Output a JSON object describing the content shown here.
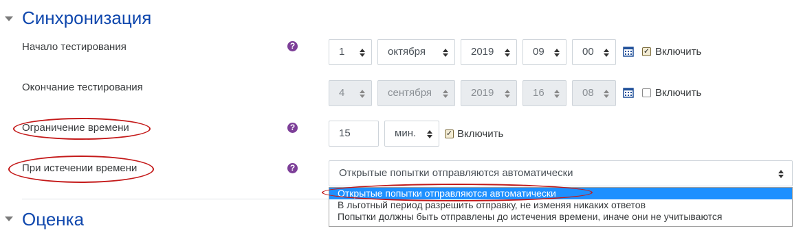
{
  "sections": {
    "sync": {
      "title": "Синхронизация"
    },
    "grade": {
      "title": "Оценка"
    }
  },
  "fields": {
    "open": {
      "label": "Начало тестирования",
      "day": "1",
      "month": "октября",
      "year": "2019",
      "hour": "09",
      "minute": "00",
      "enable_label": "Включить",
      "enabled": true
    },
    "close": {
      "label": "Окончание тестирования",
      "day": "4",
      "month": "сентября",
      "year": "2019",
      "hour": "16",
      "minute": "08",
      "enable_label": "Включить",
      "enabled": false
    },
    "timelimit": {
      "label": "Ограничение времени",
      "value": "15",
      "unit": "мин.",
      "enable_label": "Включить",
      "enabled": true
    },
    "overdue": {
      "label": "При истечении времени",
      "selected": "Открытые попытки отправляются автоматически",
      "options": [
        "Открытые попытки отправляются автоматически",
        "В льготный период разрешить отправку, не изменяя никаких ответов",
        "Попытки должны быть отправлены до истечения времени, иначе они не учитываются"
      ]
    }
  },
  "icons": {
    "help": "question-circle-icon",
    "calendar": "calendar-icon",
    "collapse": "caret-down-icon"
  },
  "colors": {
    "section_title": "#0f47ad",
    "help_icon": "#7d3f98",
    "highlight": "#1e90ff",
    "annotation": "#c41a1a"
  }
}
